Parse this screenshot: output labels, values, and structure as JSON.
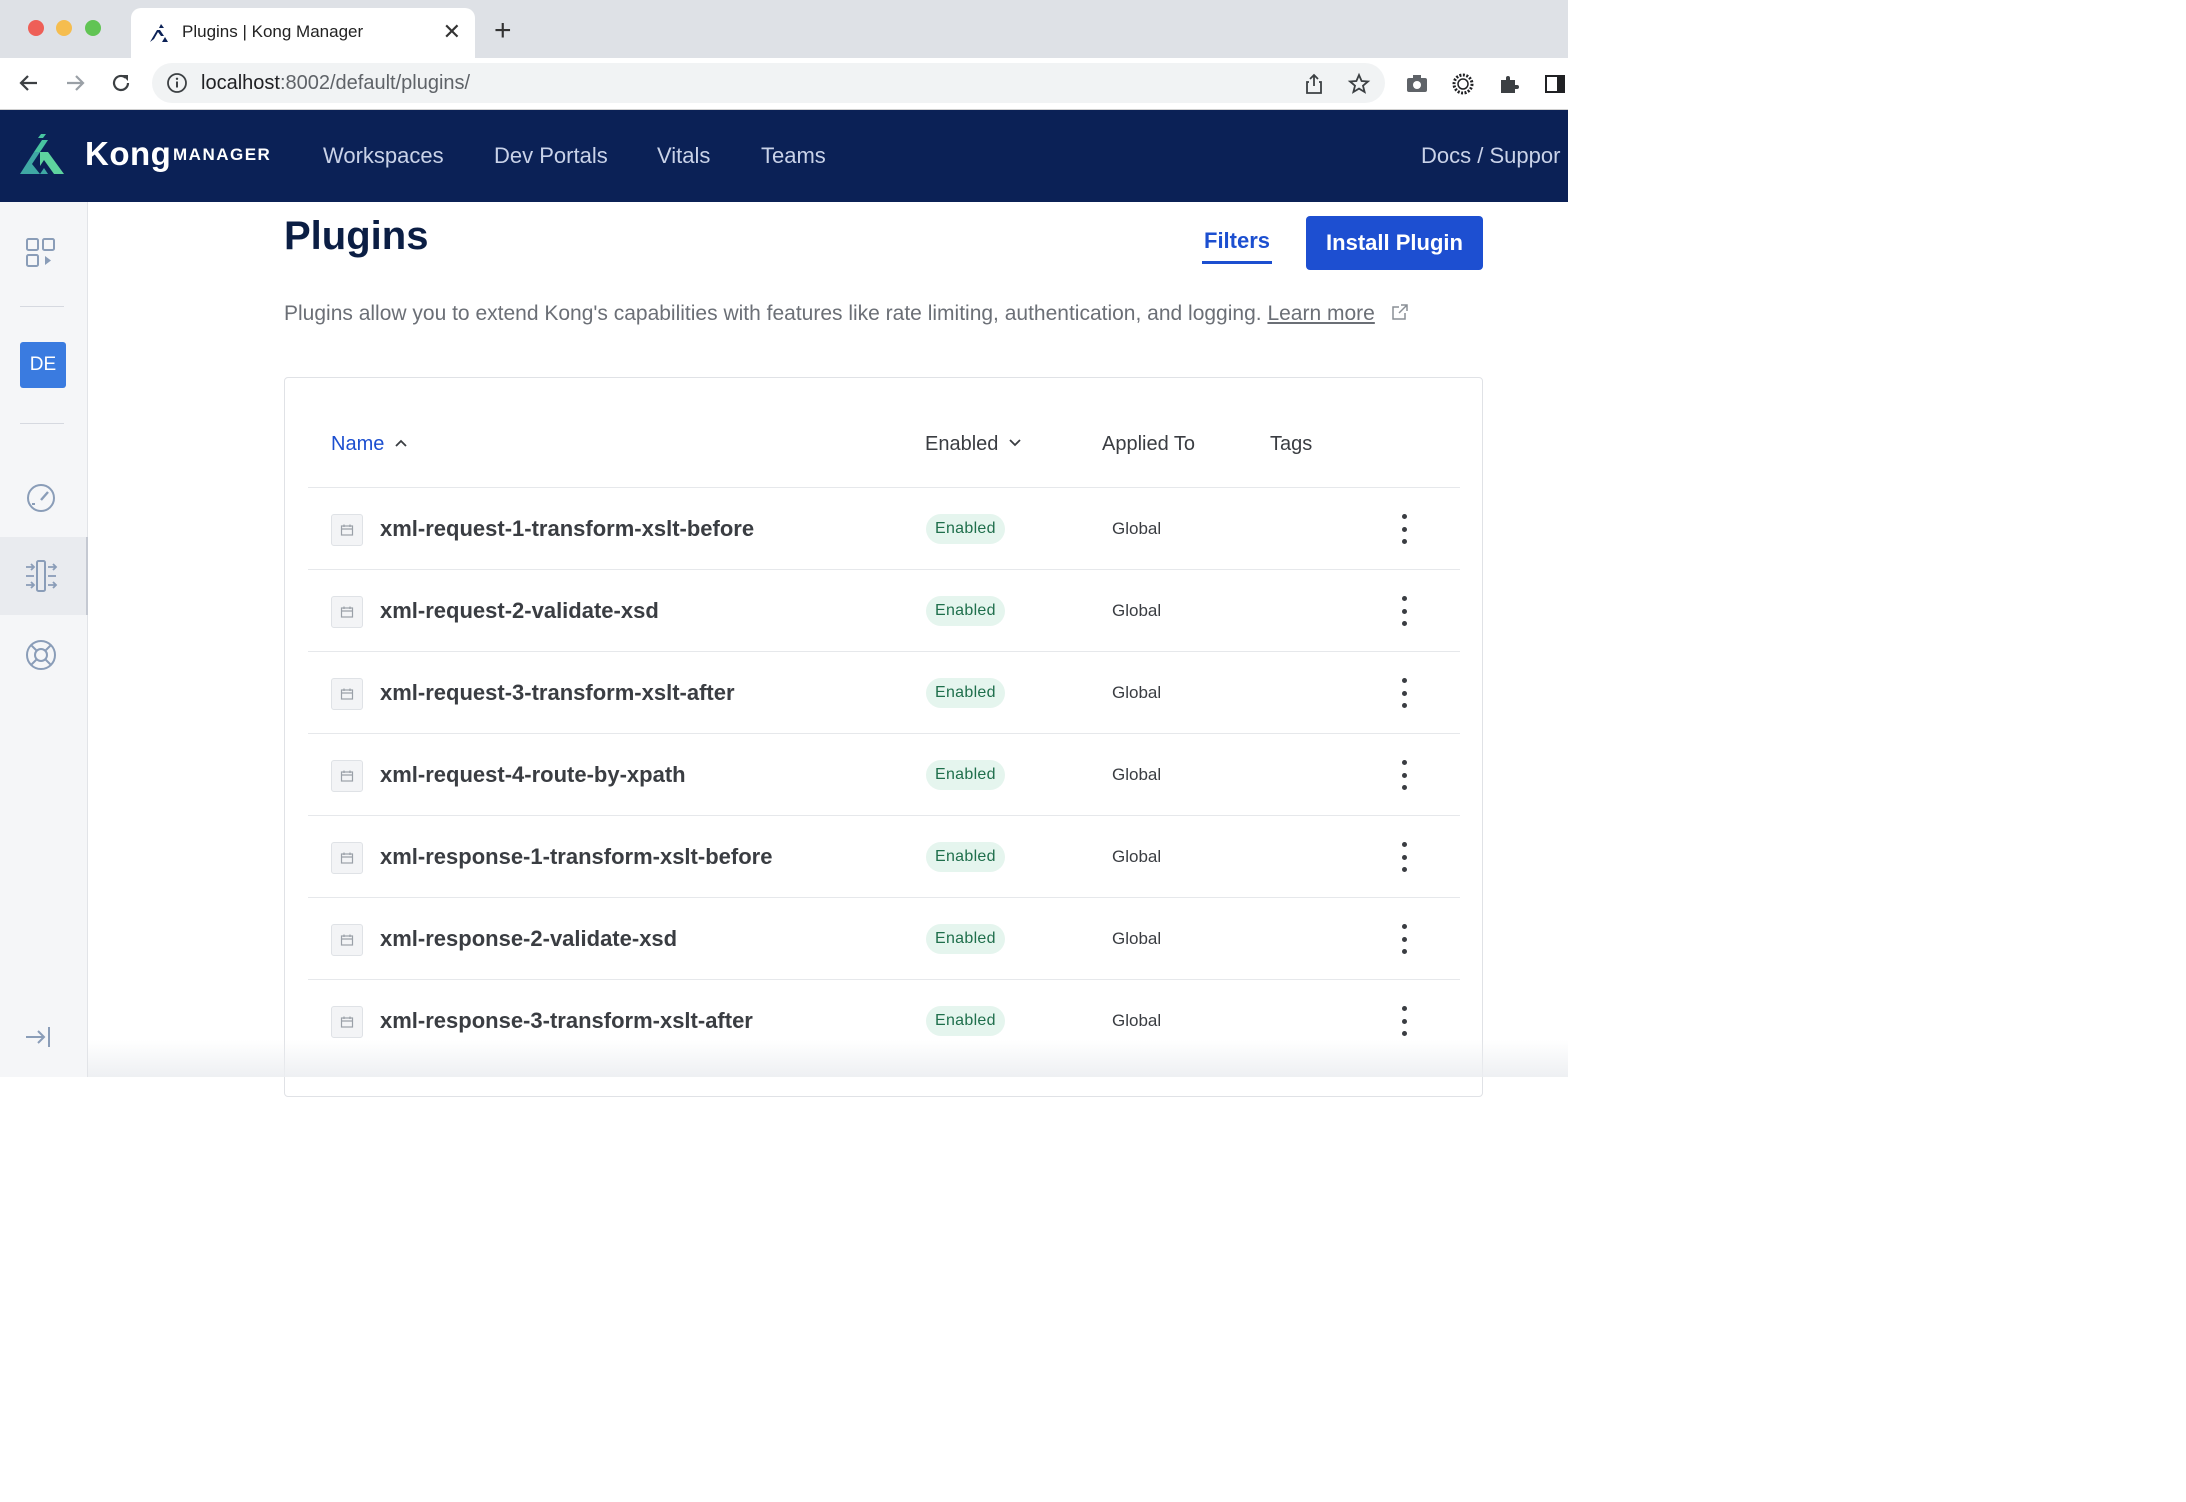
{
  "browser": {
    "tab_title": "Plugins | Kong Manager",
    "tab_close": "✕",
    "new_tab": "+",
    "url_host": "localhost",
    "url_path": ":8002/default/plugins/"
  },
  "topnav": {
    "brand": "Kong",
    "brand_sub": "MANAGER",
    "links": [
      "Workspaces",
      "Dev Portals",
      "Vitals",
      "Teams"
    ],
    "docs": "Docs / Suppor"
  },
  "sidebar": {
    "workspace_badge": "DE"
  },
  "page": {
    "title": "Plugins",
    "filters_label": "Filters",
    "install_label": "Install Plugin",
    "description": "Plugins allow you to extend Kong's capabilities with features like rate limiting, authentication, and logging.",
    "learn_more": "Learn more"
  },
  "table": {
    "columns": [
      "Name",
      "Enabled",
      "Applied To",
      "Tags"
    ],
    "rows": [
      {
        "name": "xml-request-1-transform-xslt-before",
        "enabled": "Enabled",
        "applied_to": "Global"
      },
      {
        "name": "xml-request-2-validate-xsd",
        "enabled": "Enabled",
        "applied_to": "Global"
      },
      {
        "name": "xml-request-3-transform-xslt-after",
        "enabled": "Enabled",
        "applied_to": "Global"
      },
      {
        "name": "xml-request-4-route-by-xpath",
        "enabled": "Enabled",
        "applied_to": "Global"
      },
      {
        "name": "xml-response-1-transform-xslt-before",
        "enabled": "Enabled",
        "applied_to": "Global"
      },
      {
        "name": "xml-response-2-validate-xsd",
        "enabled": "Enabled",
        "applied_to": "Global"
      },
      {
        "name": "xml-response-3-transform-xslt-after",
        "enabled": "Enabled",
        "applied_to": "Global"
      }
    ]
  },
  "colors": {
    "nav_bg": "#0b2156",
    "primary": "#1d4fd1",
    "badge_bg": "#e5f5ee",
    "badge_text": "#1f6f4c",
    "workspace_badge": "#3a7be0"
  }
}
